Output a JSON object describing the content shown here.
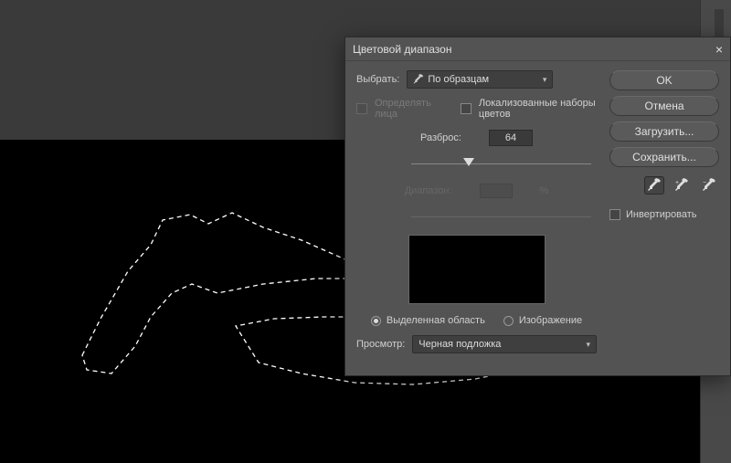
{
  "dialog": {
    "title": "Цветовой диапазон",
    "select_label": "Выбрать:",
    "select_value": "По образцам",
    "detect_faces": "Определять лица",
    "localized": "Локализованные наборы цветов",
    "fuzziness_label": "Разброс:",
    "fuzziness_value": "64",
    "range_label": "Диапазон:",
    "pct": "%",
    "radio_selection": "Выделенная область",
    "radio_image": "Изображение",
    "preview_label": "Просмотр:",
    "preview_value": "Черная подложка"
  },
  "buttons": {
    "ok": "OK",
    "cancel": "Отмена",
    "load": "Загрузить...",
    "save": "Сохранить..."
  },
  "invert": "Инвертировать",
  "colors": {
    "dialog_bg": "#535353",
    "canvas_top": "#3a3a3a"
  }
}
